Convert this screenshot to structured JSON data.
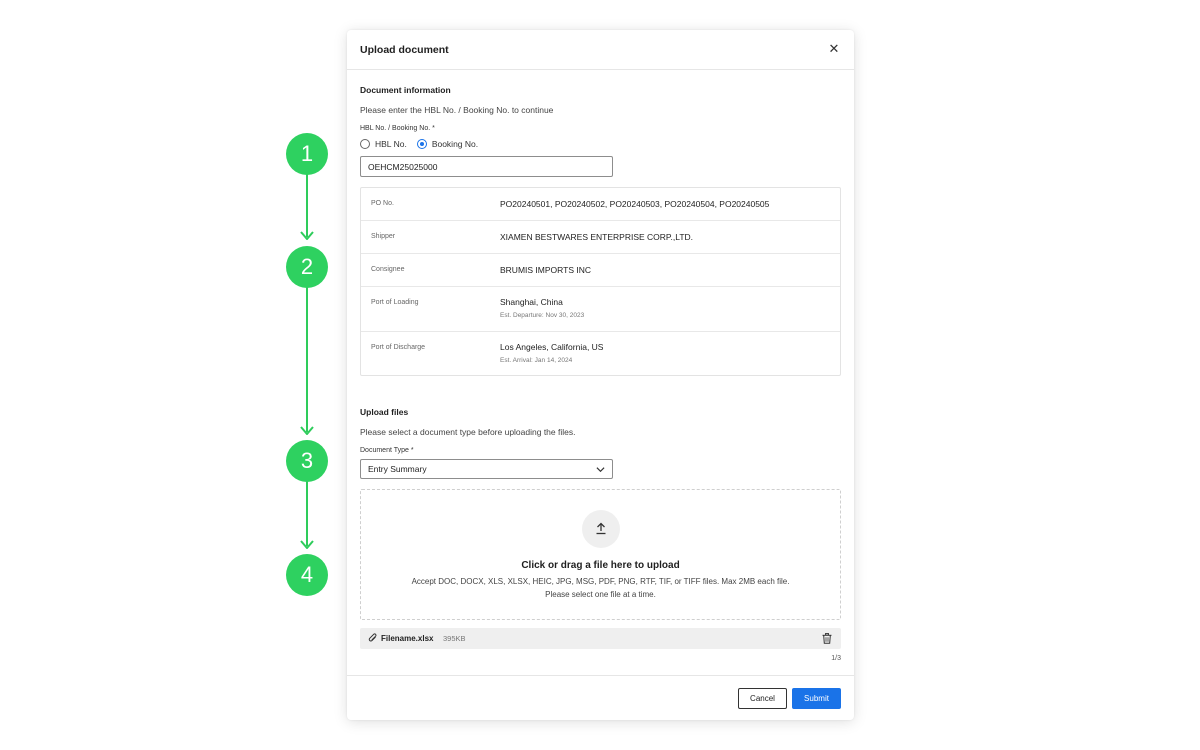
{
  "steps": [
    "1",
    "2",
    "3",
    "4"
  ],
  "colors": {
    "step_green": "#2ed160",
    "primary_blue": "#1a73e8"
  },
  "modal": {
    "title": "Upload document",
    "close_icon": "close-icon"
  },
  "document_info": {
    "section_title": "Document information",
    "helper": "Please enter the HBL No. / Booking No. to continue",
    "field_label": "HBL No. / Booking No. *",
    "radio_options": [
      {
        "label": "HBL No.",
        "checked": false
      },
      {
        "label": "Booking No.",
        "checked": true
      }
    ],
    "input_value": "OEHCM25025000",
    "rows": [
      {
        "key": "PO No.",
        "value": "PO20240501, PO20240502, PO20240503, PO20240504, PO20240505"
      },
      {
        "key": "Shipper",
        "value": "XIAMEN BESTWARES ENTERPRISE CORP.,LTD."
      },
      {
        "key": "Consignee",
        "value": "BRUMIS IMPORTS INC"
      },
      {
        "key": "Port of Loading",
        "value": "Shanghai, China",
        "sub": "Est. Departure: Nov 30, 2023"
      },
      {
        "key": "Port of Discharge",
        "value": "Los Angeles, California, US",
        "sub": "Est. Arrival: Jan 14, 2024"
      }
    ]
  },
  "upload": {
    "section_title": "Upload files",
    "helper": "Please select a document type before uploading the files.",
    "doc_type_label": "Document Type *",
    "doc_type_value": "Entry Summary",
    "dropzone_title": "Click or drag a file here to upload",
    "dropzone_line1": "Accept DOC, DOCX, XLS, XLSX, HEIC, JPG, MSG, PDF, PNG, RTF, TIF, or TIFF files. Max 2MB each file.",
    "dropzone_line2": "Please select one file at a time.",
    "file_name": "Filename.xlsx",
    "file_size": "395KB",
    "count": "1/3"
  },
  "footer": {
    "cancel_label": "Cancel",
    "submit_label": "Submit"
  }
}
